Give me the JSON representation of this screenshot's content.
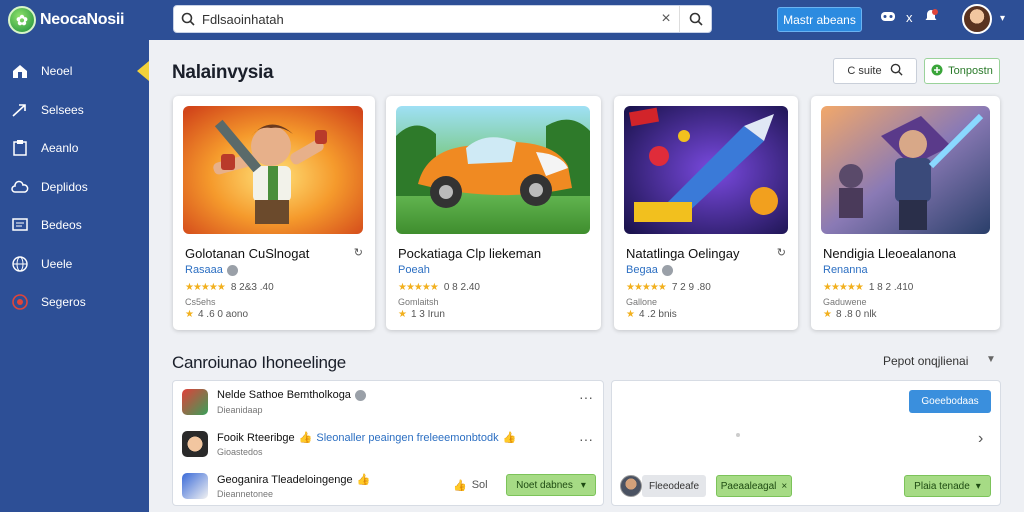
{
  "header": {
    "brand": "NeocaNosii",
    "search_value": "Fdlsaoinhatah",
    "cta_label": "Mastr abeans",
    "icon_text": "x"
  },
  "sidebar": {
    "items": [
      {
        "label": "Neoel",
        "icon": "home-icon",
        "active": true
      },
      {
        "label": "Selsees",
        "icon": "arrow-icon"
      },
      {
        "label": "Aeanlo",
        "icon": "clipboard-icon"
      },
      {
        "label": "Deplidos",
        "icon": "cloud-icon"
      },
      {
        "label": "Bedeos",
        "icon": "screen-icon"
      },
      {
        "label": "Ueele",
        "icon": "globe-icon"
      },
      {
        "label": "Segeros",
        "icon": "target-icon"
      }
    ]
  },
  "main": {
    "title": "Nalainvysia",
    "sort_label": "C suite",
    "filter_label": "Tonpostn",
    "cards": [
      {
        "title": "Golotanan CuSlnogat",
        "developer": "Rasaaa",
        "rating": "8 2&3 .40",
        "size": "Cs5ehs",
        "downloads": "4 .6 0 aono"
      },
      {
        "title": "Pockatiaga Clp liekeman",
        "developer": "Poeah",
        "rating": "0 8 2.40",
        "size": "Gomlaitsh",
        "downloads": "1 3 Irun"
      },
      {
        "title": "Natatlinga Oelingay",
        "developer": "Begaa",
        "rating": "7 2 9 .80",
        "size": "Gallone",
        "downloads": "4 .2 bnis"
      },
      {
        "title": "Nendigia Lleoealanona",
        "developer": "Renanna",
        "rating": "1 8 2 .410",
        "size": "Gaduwene",
        "downloads": "8 .8 0 nlk"
      }
    ],
    "section_title": "Canroiunao Ihoneelinge",
    "section_sort": "Pepot onqjlienai",
    "list": [
      {
        "title": "Nelde Sathoe Bemtholkoga",
        "sub": "Dieanidaap",
        "desc": ""
      },
      {
        "title": "Fooik Rteeribge",
        "sub": "Gioastedos",
        "desc": "Sleonaller peaingen freleeemonbtodk"
      },
      {
        "title": "Geoganira Tleadeloingenge",
        "sub": "Dieannetonee",
        "desc": ""
      }
    ],
    "likes": "Sol",
    "row_action": "Noet dabnes",
    "right_panel": {
      "button": "Goeebodaas",
      "chip1": "Fleeodeafe",
      "chip2": "Paeaaleagal",
      "chip3": "Plaia tenade"
    }
  }
}
